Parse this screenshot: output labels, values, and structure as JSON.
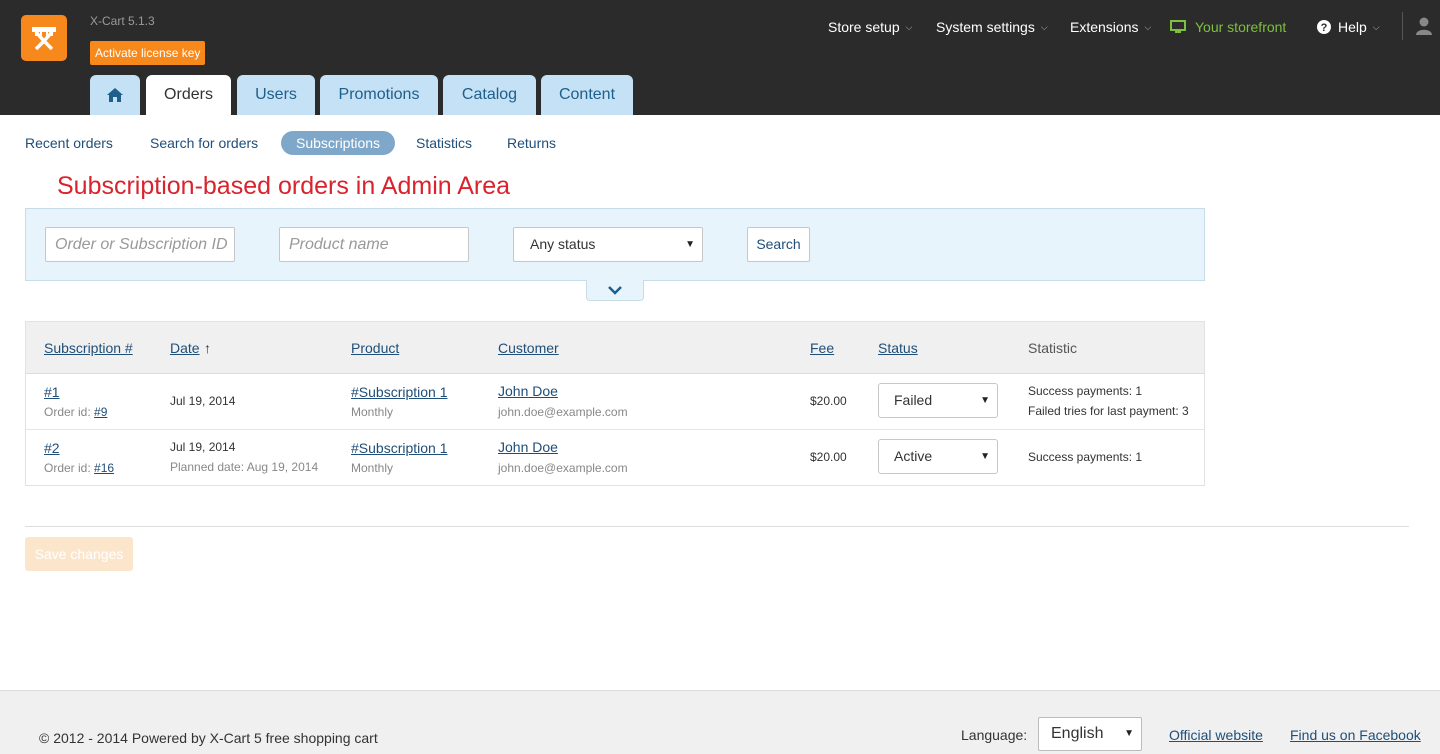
{
  "header": {
    "version": "X-Cart 5.1.3",
    "license_button": "Activate license key",
    "nav": {
      "store_setup": "Store setup",
      "system_settings": "System settings",
      "extensions": "Extensions",
      "storefront": "Your storefront",
      "help": "Help"
    }
  },
  "tabs": [
    "Orders",
    "Users",
    "Promotions",
    "Catalog",
    "Content"
  ],
  "subnav": {
    "recent": "Recent orders",
    "search": "Search for orders",
    "subscriptions": "Subscriptions",
    "statistics": "Statistics",
    "returns": "Returns"
  },
  "page_heading": "Subscription-based orders in Admin Area",
  "filter": {
    "id_placeholder": "Order or Subscription ID",
    "product_placeholder": "Product name",
    "status_value": "Any status",
    "search_button": "Search"
  },
  "table": {
    "columns": {
      "subscription": "Subscription #",
      "date": "Date",
      "date_sort": "↑",
      "product": "Product",
      "customer": "Customer",
      "fee": "Fee",
      "status": "Status",
      "statistic": "Statistic"
    },
    "order_id_label": "Order id:",
    "rows": [
      {
        "id": "#1",
        "order_id": "#9",
        "date": "Jul 19, 2014",
        "planned": "",
        "product": "#Subscription 1",
        "period": "Monthly",
        "customer": "John Doe",
        "email": "john.doe@example.com",
        "fee": "$20.00",
        "status": "Failed",
        "stat1": "Success payments: 1",
        "stat2": "Failed tries for last payment: 3"
      },
      {
        "id": "#2",
        "order_id": "#16",
        "date": "Jul 19, 2014",
        "planned": "Planned date: Aug 19, 2014",
        "product": "#Subscription 1",
        "period": "Monthly",
        "customer": "John Doe",
        "email": "john.doe@example.com",
        "fee": "$20.00",
        "status": "Active",
        "stat1": "Success payments: 1",
        "stat2": ""
      }
    ]
  },
  "save_button": "Save changes",
  "footer": {
    "copyright": "© 2012 - 2014 Powered by X-Cart 5 free shopping cart",
    "language_label": "Language:",
    "language_value": "English",
    "official_website": "Official website",
    "facebook": "Find us on Facebook"
  },
  "colors": {
    "topbar": "#2b2b2b",
    "accent_orange": "#f7891c",
    "tab_blue": "#c4e1f5",
    "heading_red": "#d9232d",
    "link_blue": "#1f4e79",
    "storefront_green": "#7fbf3f"
  }
}
